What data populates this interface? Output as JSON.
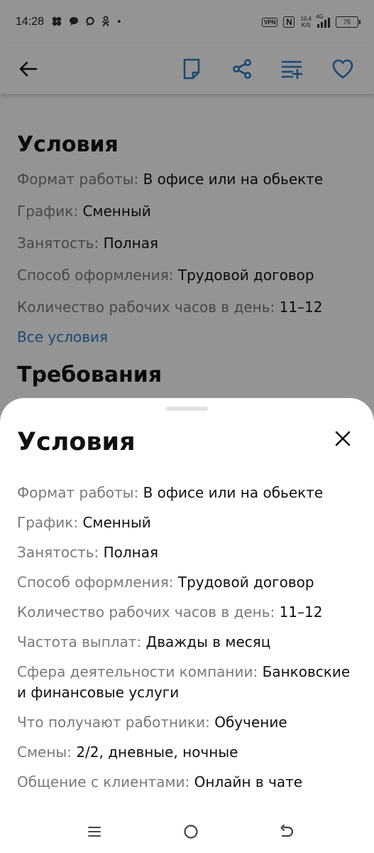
{
  "status_bar": {
    "time": "14:28",
    "dot": "•",
    "vpn": "VPN",
    "nfc": "N",
    "speed_value": "10,4",
    "speed_unit": "K/S",
    "network": "4G",
    "battery": "75"
  },
  "app_bar": {
    "icons": [
      "back-arrow-icon",
      "note-icon",
      "share-icon",
      "add-to-list-icon",
      "heart-icon"
    ],
    "accent_color": "#2e7ec8"
  },
  "background": {
    "conditions_title": "Условия",
    "rows": [
      {
        "label": "Формат работы:",
        "value": "В офисе или на обьекте"
      },
      {
        "label": "График:",
        "value": "Сменный"
      },
      {
        "label": "Занятость:",
        "value": "Полная"
      },
      {
        "label": "Способ оформления:",
        "value": "Трудовой договор"
      },
      {
        "label": "Количество рабочих часов в день:",
        "value": "11–12"
      }
    ],
    "all_conditions_link": "Все условия",
    "requirements_title": "Требования"
  },
  "sheet": {
    "title": "Условия",
    "rows": [
      {
        "label": "Формат работы:",
        "value": "В офисе или на обьекте"
      },
      {
        "label": "График:",
        "value": "Сменный"
      },
      {
        "label": "Занятость:",
        "value": "Полная"
      },
      {
        "label": "Способ оформления:",
        "value": "Трудовой договор"
      },
      {
        "label": "Количество рабочих часов в день:",
        "value": "11–12"
      },
      {
        "label": "Частота выплат:",
        "value": "Дважды в месяц"
      },
      {
        "label": "Сфера деятельности компании:",
        "value": "Банковские и финансовые услуги"
      },
      {
        "label": "Что получают работники:",
        "value": "Обучение"
      },
      {
        "label": "Смены:",
        "value": "2/2, дневные, ночные"
      },
      {
        "label": "Общение с клиентами:",
        "value": "Онлайн в чате"
      }
    ]
  },
  "nav_bar": {
    "icons": [
      "menu-icon",
      "home-icon",
      "back-icon"
    ]
  }
}
